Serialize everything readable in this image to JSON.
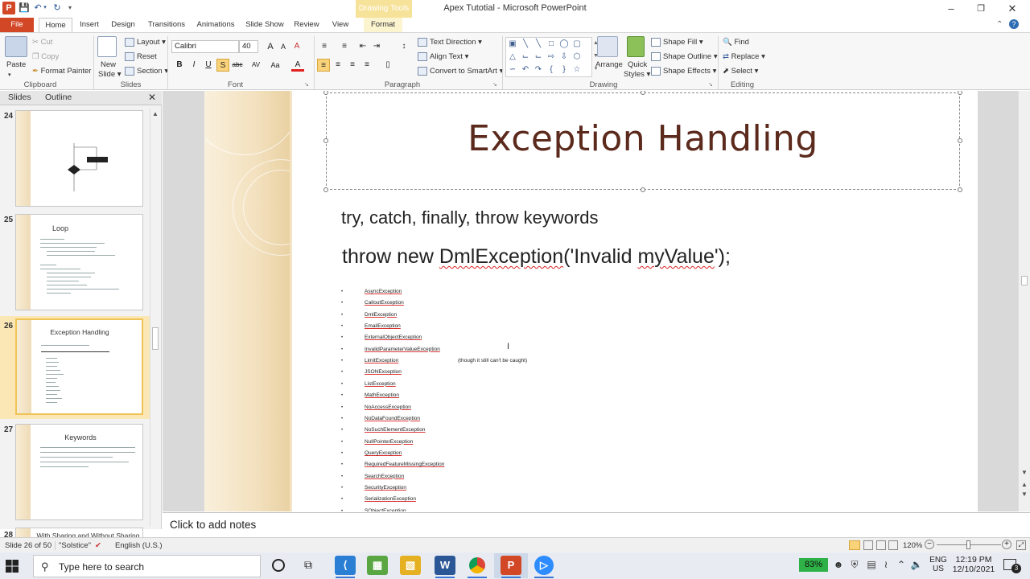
{
  "titlebar": {
    "window_title": "Apex Tutotial - Microsoft PowerPoint",
    "contextual_group": "Drawing Tools",
    "app_logo": "P",
    "minimize": "–",
    "maximize": "❐",
    "close": "✕"
  },
  "tabs": [
    "File",
    "Home",
    "Insert",
    "Design",
    "Transitions",
    "Animations",
    "Slide Show",
    "Review",
    "View",
    "Format"
  ],
  "ribbon": {
    "clipboard": {
      "paste": "Paste",
      "cut": "Cut",
      "copy": "Copy",
      "format_painter": "Format Painter",
      "label": "Clipboard"
    },
    "slides": {
      "new_slide": "New",
      "new_slide2": "Slide ▾",
      "layout": "Layout ▾",
      "reset": "Reset",
      "section": "Section ▾",
      "label": "Slides"
    },
    "font": {
      "font_name": "Calibri",
      "font_size": "40",
      "label": "Font",
      "bold": "B",
      "italic": "I",
      "underline": "U",
      "shadow": "S",
      "strike": "abc",
      "spacing": "AV",
      "case": "Aa",
      "color": "A",
      "grow": "A",
      "shrink": "A",
      "clear": "A"
    },
    "paragraph": {
      "text_direction": "Text Direction ▾",
      "align_text": "Align Text ▾",
      "convert_smartart": "Convert to SmartArt ▾",
      "label": "Paragraph"
    },
    "drawing": {
      "arrange": "Arrange",
      "quick_styles": "Quick",
      "quick_styles2": "Styles ▾",
      "shape_fill": "Shape Fill ▾",
      "shape_outline": "Shape Outline ▾",
      "shape_effects": "Shape Effects ▾",
      "label": "Drawing"
    },
    "editing": {
      "find": "Find",
      "replace": "Replace ▾",
      "select": "Select ▾",
      "label": "Editing"
    }
  },
  "panel": {
    "tab_slides": "Slides",
    "tab_outline": "Outline",
    "close": "✕",
    "thumbs": [
      {
        "num": "24",
        "title": ""
      },
      {
        "num": "25",
        "title": "Loop"
      },
      {
        "num": "26",
        "title": "Exception Handling"
      },
      {
        "num": "27",
        "title": "Keywords"
      },
      {
        "num": "28",
        "title": "With Sharing and Without Sharing"
      }
    ]
  },
  "slide": {
    "title": "Exception Handling",
    "keywords_line": "try, catch, finally, throw keywords",
    "throw_pre": "throw new ",
    "throw_class": "DmlException",
    "throw_mid": "('Invalid ",
    "throw_word": "myValue",
    "throw_post": "');",
    "exceptions": [
      {
        "name": "AsyncException",
        "note": ""
      },
      {
        "name": "CalloutException",
        "note": ""
      },
      {
        "name": "DmlException",
        "note": ""
      },
      {
        "name": "EmailException",
        "note": ""
      },
      {
        "name": "ExternalObjectException",
        "note": ""
      },
      {
        "name": "InvalidParameterValueException",
        "note": ""
      },
      {
        "name": "LimitException",
        "note": "(though it still can't be caught)"
      },
      {
        "name": "JSONException",
        "note": ""
      },
      {
        "name": "ListException",
        "note": ""
      },
      {
        "name": "MathException",
        "note": ""
      },
      {
        "name": "NoAccessException",
        "note": ""
      },
      {
        "name": "NoDataFoundException",
        "note": ""
      },
      {
        "name": "NoSuchElementException",
        "note": ""
      },
      {
        "name": "NullPointerException",
        "note": ""
      },
      {
        "name": "QueryException",
        "note": ""
      },
      {
        "name": "RequiredFeatureMissingException",
        "note": ""
      },
      {
        "name": "SearchException",
        "note": ""
      },
      {
        "name": "SecurityException",
        "note": ""
      },
      {
        "name": "SerializationException",
        "note": ""
      },
      {
        "name": "SObjectException",
        "note": ""
      }
    ]
  },
  "notes": {
    "placeholder": "Click to add notes"
  },
  "statusbar": {
    "slide_info": "Slide 26 of 50",
    "theme": "\"Solstice\"",
    "language": "English (U.S.)",
    "zoom": "120%"
  },
  "taskbar": {
    "search_placeholder": "Type here to search",
    "battery": "83%",
    "lang_top": "ENG",
    "lang_bottom": "US",
    "time": "12:19 PM",
    "date": "12/10/2021",
    "notif_count": "3"
  },
  "colors": {
    "accent": "#d24726",
    "title_color": "#5b2a1c",
    "selection": "#f0c356",
    "battery": "#2eb247"
  }
}
